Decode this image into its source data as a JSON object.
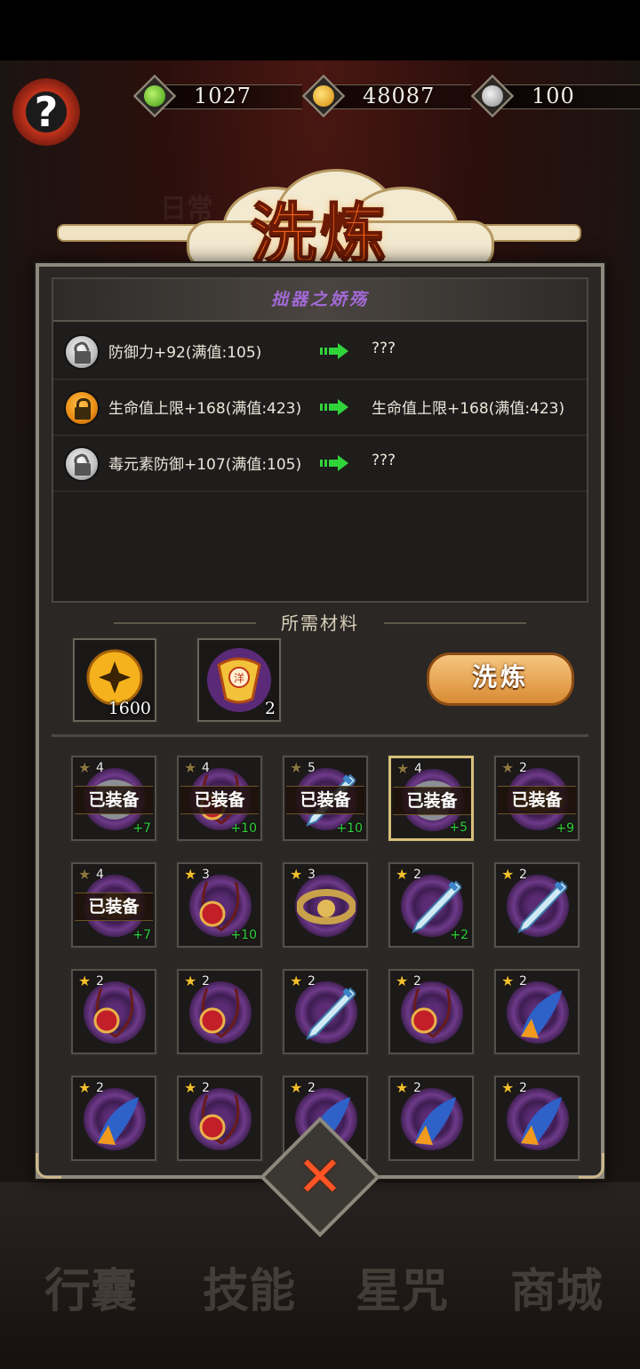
{
  "currencies": [
    {
      "icon": "jade-drop-icon",
      "value": "1027",
      "color": "#5fc22a"
    },
    {
      "icon": "gold-coin-icon",
      "value": "48087",
      "color": "#f2b31c"
    },
    {
      "icon": "silver-swirl-icon",
      "value": "100",
      "color": "#bdbdbd"
    }
  ],
  "background_labels": [
    "日常",
    "行囊",
    "技能",
    "星咒",
    "商城"
  ],
  "title": "洗炼",
  "equipment_name": "拙器之娇殇",
  "stats": [
    {
      "locked": false,
      "current": "防御力+92(满值:105)",
      "result": "???"
    },
    {
      "locked": true,
      "current": "生命值上限+168(满值:423)",
      "result": "生命值上限+168(满值:423)"
    },
    {
      "locked": false,
      "current": "毒元素防御+107(满值:105)",
      "result": "???"
    }
  ],
  "materials": {
    "title": "所需材料",
    "items": [
      {
        "icon": "gold-coin-icon",
        "count": "1600"
      },
      {
        "icon": "refine-scroll-icon",
        "count": "2"
      }
    ]
  },
  "refine_button": "洗炼",
  "items": [
    {
      "stars": "4",
      "equipped": "已装备",
      "plus": "+7",
      "art": "mask",
      "dim": true
    },
    {
      "stars": "4",
      "equipped": "已装备",
      "plus": "+10",
      "art": "amulet",
      "dim": true
    },
    {
      "stars": "5",
      "equipped": "已装备",
      "plus": "+10",
      "art": "sword",
      "dim": true
    },
    {
      "stars": "4",
      "equipped": "已装备",
      "plus": "+5",
      "art": "mask",
      "dim": true,
      "selected": true
    },
    {
      "stars": "2",
      "equipped": "已装备",
      "plus": "+9",
      "art": "hat",
      "dim": true
    },
    {
      "stars": "4",
      "equipped": "已装备",
      "plus": "+7",
      "art": "hat",
      "dim": true
    },
    {
      "stars": "3",
      "equipped": "",
      "plus": "+10",
      "art": "amulet"
    },
    {
      "stars": "3",
      "equipped": "",
      "plus": "",
      "art": "ring"
    },
    {
      "stars": "2",
      "equipped": "",
      "plus": "+2",
      "art": "sword"
    },
    {
      "stars": "2",
      "equipped": "",
      "plus": "",
      "art": "sword"
    },
    {
      "stars": "2",
      "equipped": "",
      "plus": "",
      "art": "amulet"
    },
    {
      "stars": "2",
      "equipped": "",
      "plus": "",
      "art": "amulet"
    },
    {
      "stars": "2",
      "equipped": "",
      "plus": "",
      "art": "sword"
    },
    {
      "stars": "2",
      "equipped": "",
      "plus": "",
      "art": "amulet"
    },
    {
      "stars": "2",
      "equipped": "",
      "plus": "",
      "art": "plume"
    },
    {
      "stars": "2",
      "equipped": "",
      "plus": "",
      "art": "plume"
    },
    {
      "stars": "2",
      "equipped": "",
      "plus": "",
      "art": "amulet"
    },
    {
      "stars": "2",
      "equipped": "",
      "plus": "",
      "art": "plume"
    },
    {
      "stars": "2",
      "equipped": "",
      "plus": "",
      "art": "plume"
    },
    {
      "stars": "2",
      "equipped": "",
      "plus": "",
      "art": "plume"
    }
  ]
}
